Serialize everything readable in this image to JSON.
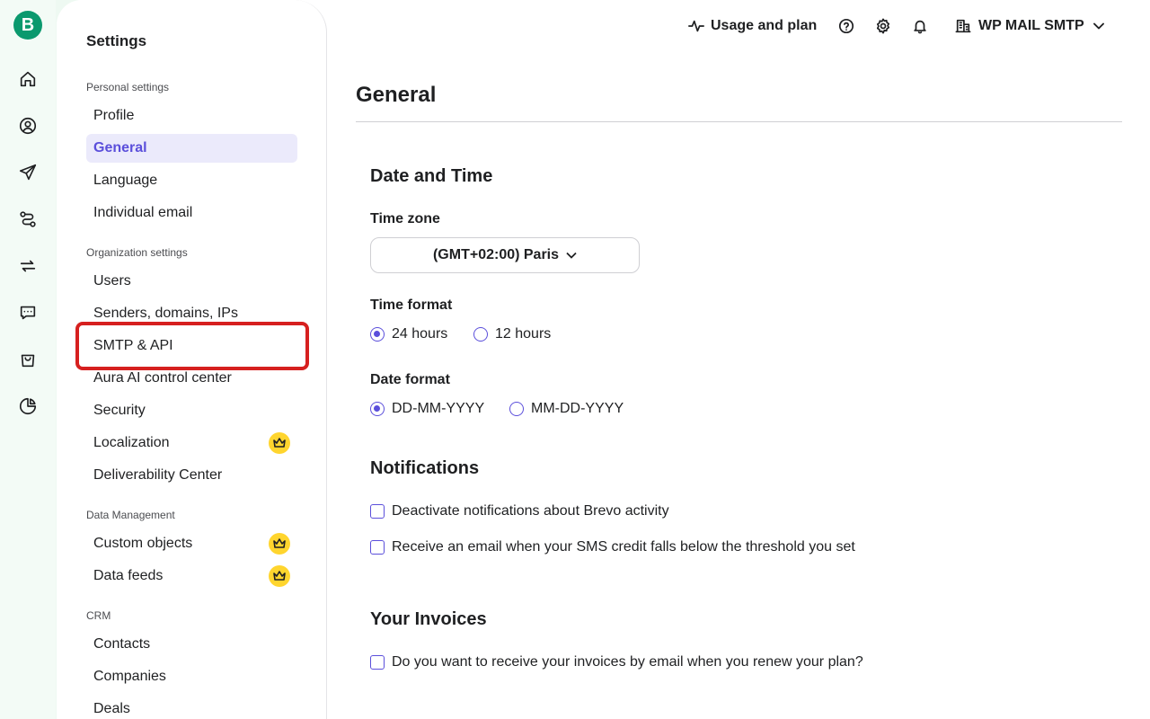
{
  "logo": {
    "letter": "B"
  },
  "rail": [
    "home-icon",
    "contacts-icon",
    "campaigns-icon",
    "automations-icon",
    "transactional-icon",
    "conversations-icon",
    "ecommerce-icon",
    "reports-icon"
  ],
  "topbar": {
    "usage": "Usage and plan",
    "account": "WP MAIL SMTP"
  },
  "sidebar": {
    "title": "Settings",
    "sections": {
      "personal": "Personal settings",
      "organization": "Organization settings",
      "data": "Data Management",
      "crm": "CRM"
    },
    "items": {
      "profile": "Profile",
      "general": "General",
      "language": "Language",
      "individual_email": "Individual email",
      "users": "Users",
      "senders": "Senders, domains, IPs",
      "smtp": "SMTP & API",
      "aura": "Aura AI control center",
      "security": "Security",
      "localization": "Localization",
      "deliverability": "Deliverability Center",
      "custom_objects": "Custom objects",
      "data_feeds": "Data feeds",
      "contacts": "Contacts",
      "companies": "Companies",
      "deals": "Deals"
    }
  },
  "main": {
    "title": "General",
    "date_time": {
      "heading": "Date and Time",
      "timezone_label": "Time zone",
      "timezone_value": "(GMT+02:00) Paris",
      "time_format_label": "Time format",
      "time_24": "24 hours",
      "time_12": "12 hours",
      "date_format_label": "Date format",
      "date_dmy": "DD-MM-YYYY",
      "date_mdy": "MM-DD-YYYY"
    },
    "notifications": {
      "heading": "Notifications",
      "opt1": "Deactivate notifications about Brevo activity",
      "opt2": "Receive an email when your SMS credit falls below the threshold you set"
    },
    "invoices": {
      "heading": "Your Invoices",
      "opt1": "Do you want to receive your invoices by email when you renew your plan?"
    }
  },
  "colors": {
    "accent": "#5b4fdb",
    "brand": "#0b996e",
    "highlight": "#d6201f",
    "premium": "#ffd52e"
  }
}
